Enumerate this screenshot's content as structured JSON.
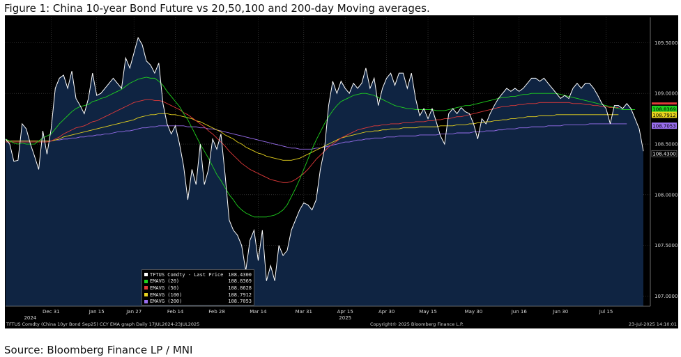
{
  "figure": {
    "title": "Figure 1: China 10-year Bond Future vs 20,50,100 and 200-day Moving averages.",
    "source": "Source: Bloomberg Finance LP / MNI"
  },
  "footer": {
    "left": "TFTUS Comdty (China 10yr Bond  Sep25) CCY EMA graph  Daily 17JUL2024-23JUL2025",
    "center": "Copyright© 2025 Bloomberg Finance L.P.",
    "right": "23-Jul-2025 14:10:01"
  },
  "legend": [
    {
      "name": "TFTUS Comdty - Last Price",
      "value": "108.4300",
      "color": "#ffffff"
    },
    {
      "name": "EMAVG (20)",
      "value": "108.8369",
      "color": "#1fd21f"
    },
    {
      "name": "EMAVG (50)",
      "value": "108.8628",
      "color": "#e23a3a"
    },
    {
      "name": "EMAVG (100)",
      "value": "108.7912",
      "color": "#e8d41e"
    },
    {
      "name": "EMAVG (200)",
      "value": "108.7053",
      "color": "#9a6ff0"
    }
  ],
  "chart_data": {
    "type": "line",
    "ylim": [
      106.9,
      109.75
    ],
    "y_ticks": [
      "109.5000",
      "109.0000",
      "108.5000",
      "108.0000",
      "107.5000",
      "107.0000"
    ],
    "x_ticks": [
      "Dec 31",
      "Jan 15",
      "Jan 27",
      "Feb 14",
      "Feb 28",
      "Mar 14",
      "Mar 31",
      "Apr 15",
      "Apr 30",
      "May 15",
      "May 30",
      "Jun 16",
      "Jun 30",
      "Jul 15"
    ],
    "year_labels": [
      {
        "label": "2024",
        "under": "Dec 31"
      },
      {
        "label": "2025",
        "under": "Apr 15"
      }
    ],
    "value_tags": [
      {
        "text": "108.8369",
        "value": 108.8369,
        "color": "#1fd21f",
        "text_color": "#000000"
      },
      {
        "text": "108.7912",
        "value": 108.79,
        "color": "#e8d41e",
        "text_color": "#000000"
      },
      {
        "text": "108.7053",
        "value": 108.7053,
        "color": "#9a6ff0",
        "text_color": "#000000"
      },
      {
        "text": "108.4300",
        "value": 108.43,
        "color": "#000000",
        "text_color": "#ffffff"
      }
    ],
    "series": [
      {
        "name": "TFTUS Comdty - Last Price",
        "color": "#ffffff",
        "values": [
          108.55,
          108.5,
          108.33,
          108.34,
          108.7,
          108.65,
          108.5,
          108.38,
          108.25,
          108.63,
          108.4,
          108.65,
          109.05,
          109.15,
          109.18,
          109.05,
          109.22,
          108.95,
          108.88,
          108.8,
          108.95,
          109.2,
          108.98,
          109.0,
          109.05,
          109.1,
          109.15,
          109.1,
          109.05,
          109.35,
          109.25,
          109.4,
          109.55,
          109.48,
          109.32,
          109.28,
          109.2,
          109.3,
          108.9,
          108.7,
          108.6,
          108.68,
          108.5,
          108.28,
          107.95,
          108.25,
          108.1,
          108.5,
          108.1,
          108.25,
          108.55,
          108.45,
          108.6,
          108.2,
          107.75,
          107.65,
          107.6,
          107.5,
          107.25,
          107.55,
          107.65,
          107.35,
          107.65,
          107.15,
          107.3,
          107.15,
          107.5,
          107.4,
          107.45,
          107.65,
          107.75,
          107.85,
          107.92,
          107.9,
          107.85,
          107.95,
          108.25,
          108.45,
          108.88,
          109.12,
          109.0,
          109.12,
          109.05,
          109.0,
          109.1,
          109.05,
          109.1,
          109.25,
          109.05,
          109.15,
          108.88,
          109.05,
          109.15,
          109.2,
          109.08,
          109.2,
          109.2,
          109.05,
          109.2,
          108.95,
          108.78,
          108.85,
          108.75,
          108.85,
          108.72,
          108.58,
          108.5,
          108.8,
          108.85,
          108.8,
          108.86,
          108.82,
          108.8,
          108.7,
          108.55,
          108.75,
          108.7,
          108.8,
          108.88,
          108.95,
          109.0,
          109.05,
          109.02,
          109.05,
          109.02,
          109.05,
          109.1,
          109.15,
          109.15,
          109.12,
          109.15,
          109.1,
          109.05,
          109.0,
          108.95,
          108.98,
          108.95,
          109.05,
          109.1,
          109.05,
          109.1,
          109.1,
          109.05,
          108.98,
          108.9,
          108.85,
          108.7,
          108.88,
          108.88,
          108.85,
          108.9,
          108.85,
          108.75,
          108.65,
          108.43
        ]
      },
      {
        "name": "EMAVG (20)",
        "color": "#1fd21f",
        "values": [
          108.55,
          108.53,
          108.51,
          108.5,
          108.51,
          108.5,
          108.5,
          108.5,
          108.53,
          108.56,
          108.58,
          108.6,
          108.65,
          108.7,
          108.74,
          108.78,
          108.82,
          108.85,
          108.87,
          108.88,
          108.89,
          108.92,
          108.93,
          108.95,
          108.96,
          108.98,
          109.0,
          109.02,
          109.04,
          109.07,
          109.1,
          109.12,
          109.14,
          109.15,
          109.16,
          109.15,
          109.15,
          109.12,
          109.08,
          109.02,
          108.97,
          108.92,
          108.87,
          108.8,
          108.74,
          108.66,
          108.58,
          108.5,
          108.43,
          108.36,
          108.28,
          108.2,
          108.14,
          108.07,
          108.0,
          107.95,
          107.89,
          107.85,
          107.82,
          107.8,
          107.78,
          107.78,
          107.78,
          107.78,
          107.79,
          107.8,
          107.82,
          107.85,
          107.9,
          107.98,
          108.06,
          108.15,
          108.25,
          108.35,
          108.45,
          108.54,
          108.62,
          108.7,
          108.77,
          108.83,
          108.88,
          108.92,
          108.94,
          108.96,
          108.98,
          108.99,
          109.0,
          109.0,
          108.99,
          108.98,
          108.96,
          108.94,
          108.92,
          108.9,
          108.88,
          108.87,
          108.86,
          108.85,
          108.85,
          108.84,
          108.84,
          108.84,
          108.84,
          108.84,
          108.83,
          108.83,
          108.83,
          108.84,
          108.85,
          108.86,
          108.87,
          108.88,
          108.88,
          108.89,
          108.9,
          108.91,
          108.92,
          108.93,
          108.94,
          108.95,
          108.96,
          108.96,
          108.97,
          108.97,
          108.98,
          108.99,
          108.99,
          109.0,
          109.0,
          109.0,
          109.0,
          109.0,
          109.0,
          109.0,
          108.99,
          108.98,
          108.97,
          108.96,
          108.95,
          108.94,
          108.93,
          108.92,
          108.91,
          108.9,
          108.89,
          108.88,
          108.87,
          108.86,
          108.85,
          108.84,
          108.84,
          108.84,
          108.84
        ]
      },
      {
        "name": "EMAVG (50)",
        "color": "#e23a3a",
        "values": [
          108.52,
          108.52,
          108.52,
          108.52,
          108.52,
          108.52,
          108.52,
          108.52,
          108.52,
          108.52,
          108.52,
          108.53,
          108.55,
          108.57,
          108.6,
          108.62,
          108.64,
          108.66,
          108.67,
          108.68,
          108.7,
          108.72,
          108.73,
          108.75,
          108.77,
          108.79,
          108.81,
          108.83,
          108.85,
          108.87,
          108.89,
          108.91,
          108.92,
          108.93,
          108.94,
          108.94,
          108.93,
          108.93,
          108.92,
          108.9,
          108.88,
          108.86,
          108.84,
          108.81,
          108.79,
          108.76,
          108.73,
          108.7,
          108.67,
          108.63,
          108.6,
          108.56,
          108.52,
          108.48,
          108.43,
          108.39,
          108.35,
          108.31,
          108.28,
          108.25,
          108.23,
          108.21,
          108.19,
          108.17,
          108.15,
          108.14,
          108.13,
          108.12,
          108.12,
          108.13,
          108.15,
          108.18,
          108.21,
          108.25,
          108.3,
          108.35,
          108.39,
          108.43,
          108.47,
          108.5,
          108.53,
          108.56,
          108.58,
          108.6,
          108.62,
          108.64,
          108.65,
          108.66,
          108.67,
          108.68,
          108.68,
          108.69,
          108.69,
          108.7,
          108.7,
          108.7,
          108.71,
          108.71,
          108.71,
          108.72,
          108.72,
          108.72,
          108.73,
          108.73,
          108.74,
          108.74,
          108.75,
          108.75,
          108.76,
          108.77,
          108.77,
          108.78,
          108.79,
          108.8,
          108.81,
          108.82,
          108.83,
          108.84,
          108.85,
          108.86,
          108.87,
          108.87,
          108.88,
          108.88,
          108.89,
          108.89,
          108.9,
          108.9,
          108.9,
          108.91,
          108.91,
          108.91,
          108.91,
          108.91,
          108.91,
          108.91,
          108.91,
          108.9,
          108.9,
          108.9,
          108.89,
          108.89,
          108.88,
          108.88,
          108.87,
          108.87,
          108.86,
          108.86,
          108.86
        ]
      },
      {
        "name": "EMAVG (100)",
        "color": "#e8d41e",
        "values": [
          108.53,
          108.53,
          108.53,
          108.53,
          108.53,
          108.53,
          108.53,
          108.53,
          108.53,
          108.53,
          108.53,
          108.53,
          108.54,
          108.55,
          108.57,
          108.58,
          108.59,
          108.6,
          108.61,
          108.62,
          108.63,
          108.64,
          108.65,
          108.66,
          108.67,
          108.68,
          108.69,
          108.7,
          108.71,
          108.72,
          108.73,
          108.74,
          108.76,
          108.77,
          108.78,
          108.79,
          108.79,
          108.8,
          108.8,
          108.8,
          108.79,
          108.79,
          108.78,
          108.77,
          108.76,
          108.75,
          108.73,
          108.72,
          108.7,
          108.68,
          108.66,
          108.64,
          108.62,
          108.59,
          108.57,
          108.55,
          108.52,
          108.5,
          108.47,
          108.45,
          108.43,
          108.41,
          108.4,
          108.38,
          108.37,
          108.36,
          108.35,
          108.34,
          108.34,
          108.34,
          108.35,
          108.36,
          108.38,
          108.4,
          108.42,
          108.44,
          108.46,
          108.48,
          108.5,
          108.52,
          108.54,
          108.56,
          108.57,
          108.58,
          108.59,
          108.6,
          108.61,
          108.62,
          108.62,
          108.63,
          108.63,
          108.64,
          108.64,
          108.65,
          108.65,
          108.65,
          108.66,
          108.66,
          108.66,
          108.66,
          108.67,
          108.67,
          108.67,
          108.67,
          108.67,
          108.68,
          108.68,
          108.68,
          108.68,
          108.69,
          108.69,
          108.69,
          108.7,
          108.7,
          108.71,
          108.71,
          108.72,
          108.72,
          108.73,
          108.73,
          108.74,
          108.74,
          108.75,
          108.75,
          108.76,
          108.76,
          108.77,
          108.77,
          108.77,
          108.78,
          108.78,
          108.78,
          108.78,
          108.79,
          108.79,
          108.79,
          108.79,
          108.79,
          108.79,
          108.79,
          108.79,
          108.79,
          108.79,
          108.79,
          108.79,
          108.79,
          108.79,
          108.79,
          108.79
        ]
      },
      {
        "name": "EMAVG (200)",
        "color": "#9a6ff0",
        "values": [
          108.53,
          108.53,
          108.53,
          108.53,
          108.53,
          108.53,
          108.53,
          108.53,
          108.53,
          108.53,
          108.53,
          108.53,
          108.54,
          108.54,
          108.55,
          108.55,
          108.56,
          108.56,
          108.57,
          108.57,
          108.58,
          108.58,
          108.59,
          108.59,
          108.6,
          108.6,
          108.61,
          108.62,
          108.62,
          108.63,
          108.63,
          108.64,
          108.65,
          108.66,
          108.66,
          108.67,
          108.67,
          108.68,
          108.68,
          108.68,
          108.68,
          108.68,
          108.68,
          108.68,
          108.67,
          108.67,
          108.67,
          108.66,
          108.66,
          108.65,
          108.65,
          108.64,
          108.63,
          108.62,
          108.61,
          108.6,
          108.59,
          108.58,
          108.57,
          108.56,
          108.55,
          108.54,
          108.53,
          108.52,
          108.51,
          108.5,
          108.49,
          108.48,
          108.47,
          108.46,
          108.46,
          108.45,
          108.45,
          108.45,
          108.45,
          108.46,
          108.46,
          108.47,
          108.48,
          108.49,
          108.5,
          108.51,
          108.52,
          108.52,
          108.53,
          108.54,
          108.54,
          108.55,
          108.55,
          108.56,
          108.56,
          108.56,
          108.57,
          108.57,
          108.57,
          108.58,
          108.58,
          108.58,
          108.58,
          108.58,
          108.59,
          108.59,
          108.59,
          108.59,
          108.59,
          108.6,
          108.6,
          108.6,
          108.6,
          108.61,
          108.61,
          108.61,
          108.61,
          108.62,
          108.62,
          108.62,
          108.63,
          108.63,
          108.63,
          108.64,
          108.64,
          108.65,
          108.65,
          108.65,
          108.66,
          108.66,
          108.66,
          108.67,
          108.67,
          108.67,
          108.67,
          108.68,
          108.68,
          108.68,
          108.68,
          108.69,
          108.69,
          108.69,
          108.69,
          108.69,
          108.69,
          108.7,
          108.7,
          108.7,
          108.7,
          108.7,
          108.7,
          108.7,
          108.7,
          108.7,
          108.7
        ]
      }
    ]
  }
}
